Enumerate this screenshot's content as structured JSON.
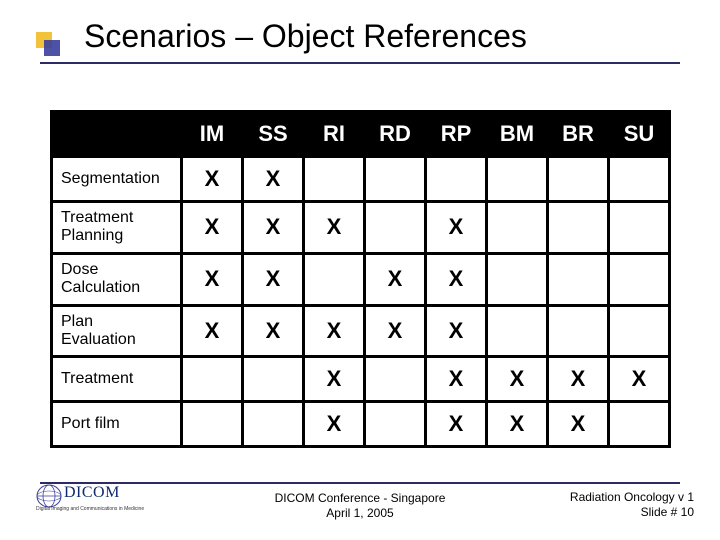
{
  "title": "Scenarios – Object References",
  "table": {
    "columns": [
      "IM",
      "SS",
      "RI",
      "RD",
      "RP",
      "BM",
      "BR",
      "SU"
    ],
    "rows": [
      {
        "label": "Segmentation",
        "marks": [
          "X",
          "X",
          "",
          "",
          "",
          "",
          "",
          ""
        ]
      },
      {
        "label": "Treatment Planning",
        "marks": [
          "X",
          "X",
          "X",
          "",
          "X",
          "",
          "",
          ""
        ]
      },
      {
        "label": "Dose Calculation",
        "marks": [
          "X",
          "X",
          "",
          "X",
          "X",
          "",
          "",
          ""
        ]
      },
      {
        "label": "Plan Evaluation",
        "marks": [
          "X",
          "X",
          "X",
          "X",
          "X",
          "",
          "",
          ""
        ]
      },
      {
        "label": "Treatment",
        "marks": [
          "",
          "",
          "X",
          "",
          "X",
          "X",
          "X",
          "X"
        ]
      },
      {
        "label": "Port film",
        "marks": [
          "",
          "",
          "X",
          "",
          "X",
          "X",
          "X",
          ""
        ]
      }
    ]
  },
  "logo": {
    "text": "DICOM",
    "subtext": "Digital Imaging and Communications in Medicine"
  },
  "footer": {
    "center_line1": "DICOM Conference - Singapore",
    "center_line2": "April 1, 2005",
    "right_line1": "Radiation Oncology   v 1",
    "right_line2": "Slide # 10"
  },
  "chart_data": {
    "type": "table",
    "title": "Scenarios – Object References",
    "columns": [
      "IM",
      "SS",
      "RI",
      "RD",
      "RP",
      "BM",
      "BR",
      "SU"
    ],
    "rows": [
      "Segmentation",
      "Treatment Planning",
      "Dose Calculation",
      "Plan Evaluation",
      "Treatment",
      "Port film"
    ],
    "matrix": [
      [
        1,
        1,
        0,
        0,
        0,
        0,
        0,
        0
      ],
      [
        1,
        1,
        1,
        0,
        1,
        0,
        0,
        0
      ],
      [
        1,
        1,
        0,
        1,
        1,
        0,
        0,
        0
      ],
      [
        1,
        1,
        1,
        1,
        1,
        0,
        0,
        0
      ],
      [
        0,
        0,
        1,
        0,
        1,
        1,
        1,
        1
      ],
      [
        0,
        0,
        1,
        0,
        1,
        1,
        1,
        0
      ]
    ]
  }
}
